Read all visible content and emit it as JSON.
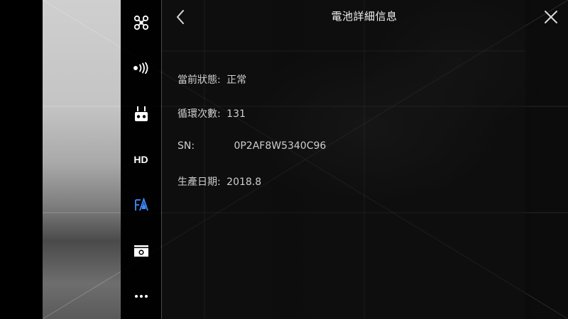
{
  "header": {
    "title": "電池詳細信息"
  },
  "sidebar": {
    "items": [
      {
        "name": "aircraft",
        "icon": "drone-icon"
      },
      {
        "name": "signal",
        "icon": "wireless-signal-icon"
      },
      {
        "name": "remote-controller",
        "icon": "remote-controller-icon"
      },
      {
        "name": "hd",
        "icon": "hd-icon",
        "label": "HD"
      },
      {
        "name": "battery",
        "icon": "battery-icon",
        "active": true
      },
      {
        "name": "camera",
        "icon": "camera-icon"
      },
      {
        "name": "more",
        "icon": "more-icon",
        "label": "•••"
      }
    ]
  },
  "battery_info": {
    "status_label": "當前狀態:",
    "status_value": "正常",
    "cycles_label": "循環次數:",
    "cycles_value": "131",
    "sn_label": "SN:",
    "sn_value": "0P2AF8W5340C96",
    "date_label": "生產日期:",
    "date_value": "2018.8"
  },
  "colors": {
    "active_icon": "#3d8cff",
    "text": "#cfcfcf",
    "title": "#f2f2f2"
  }
}
